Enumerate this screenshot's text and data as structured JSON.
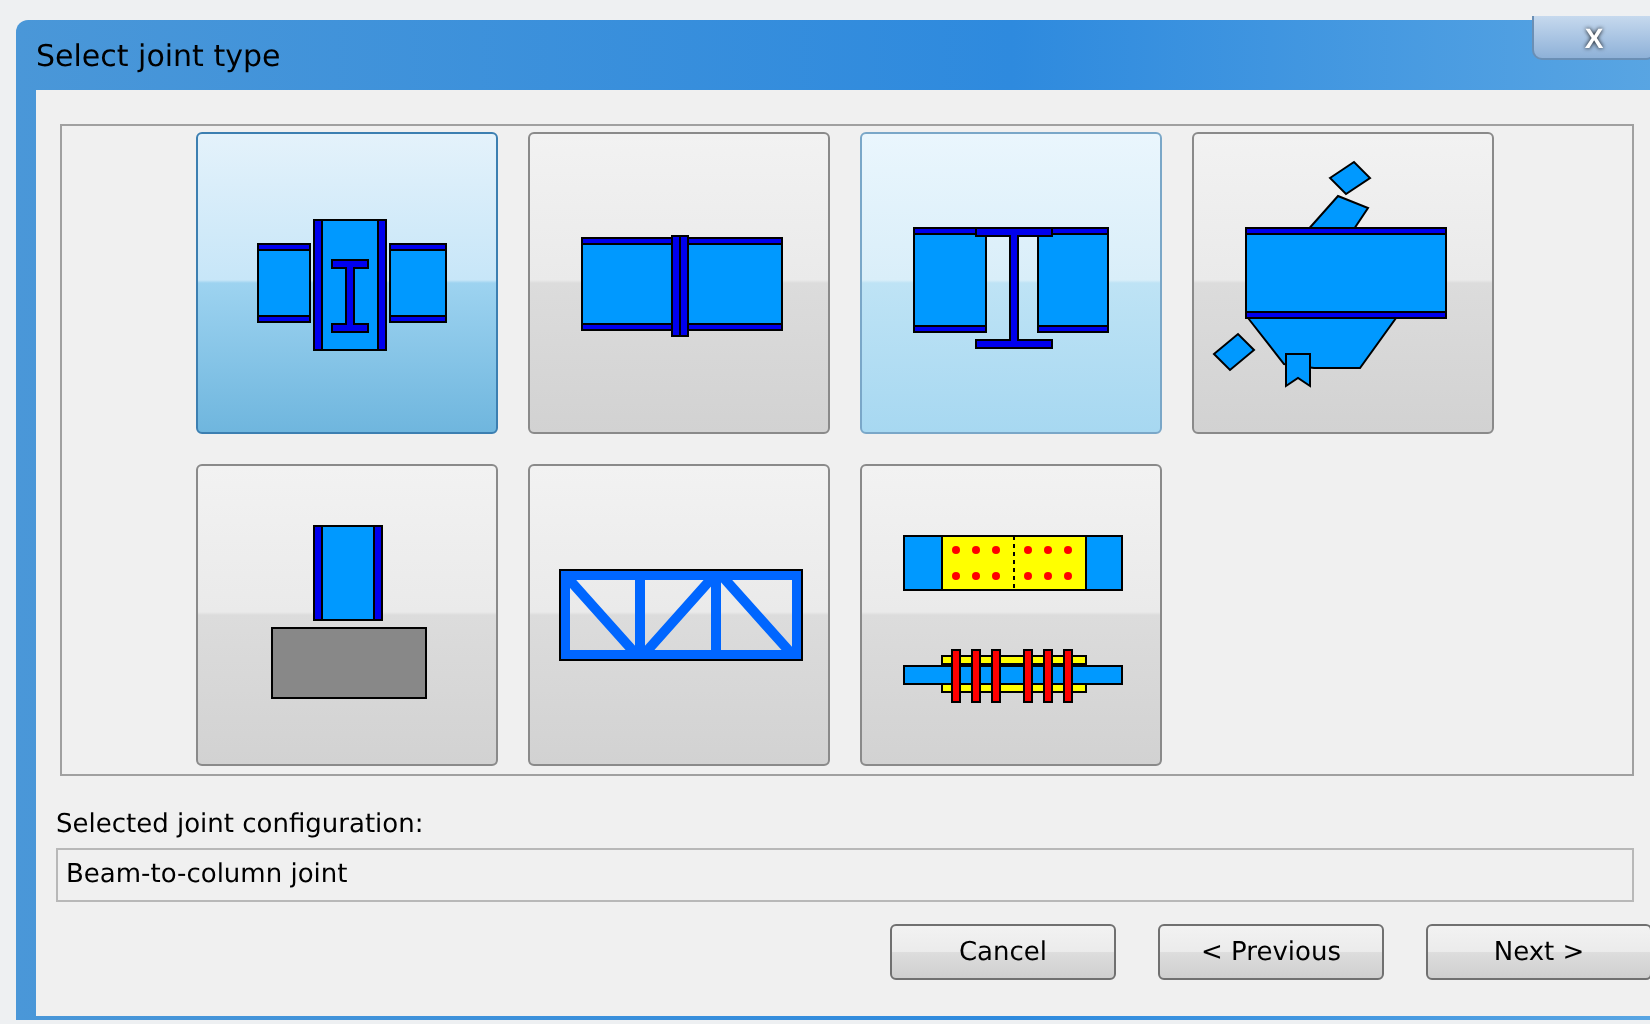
{
  "window": {
    "title": "Select joint type",
    "close": "X"
  },
  "joint_types": [
    {
      "kind": "beam-to-column",
      "selected": true,
      "hovered": false
    },
    {
      "kind": "beam-splice",
      "selected": false,
      "hovered": false
    },
    {
      "kind": "beam-to-beam",
      "selected": false,
      "hovered": true
    },
    {
      "kind": "bracing",
      "selected": false,
      "hovered": false
    },
    {
      "kind": "column-base",
      "selected": false,
      "hovered": false
    },
    {
      "kind": "truss",
      "selected": false,
      "hovered": false
    },
    {
      "kind": "bolted-splice",
      "selected": false,
      "hovered": false
    }
  ],
  "configuration": {
    "label": "Selected joint configuration:",
    "value": "Beam-to-column joint"
  },
  "buttons": [
    "Cancel",
    "< Previous",
    "Next >"
  ]
}
